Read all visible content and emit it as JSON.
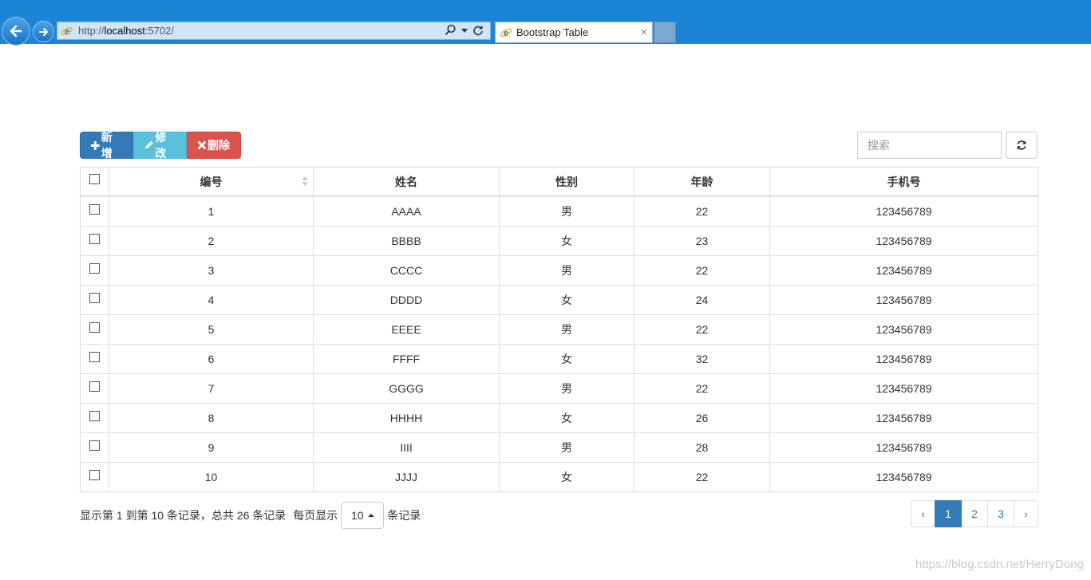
{
  "browser": {
    "url_prefix": "http://",
    "url_host": "localhost",
    "url_suffix": ":5702/",
    "tab_title": "Bootstrap Table",
    "tab_close": "×"
  },
  "toolbar": {
    "add_label": "新增",
    "edit_label": "修改",
    "delete_label": "删除"
  },
  "search": {
    "placeholder": "搜索"
  },
  "table": {
    "headers": [
      "编号",
      "姓名",
      "性别",
      "年龄",
      "手机号"
    ],
    "rows": [
      [
        "1",
        "AAAA",
        "男",
        "22",
        "123456789"
      ],
      [
        "2",
        "BBBB",
        "女",
        "23",
        "123456789"
      ],
      [
        "3",
        "CCCC",
        "男",
        "22",
        "123456789"
      ],
      [
        "4",
        "DDDD",
        "女",
        "24",
        "123456789"
      ],
      [
        "5",
        "EEEE",
        "男",
        "22",
        "123456789"
      ],
      [
        "6",
        "FFFF",
        "女",
        "32",
        "123456789"
      ],
      [
        "7",
        "GGGG",
        "男",
        "22",
        "123456789"
      ],
      [
        "8",
        "HHHH",
        "女",
        "26",
        "123456789"
      ],
      [
        "9",
        "IIII",
        "男",
        "28",
        "123456789"
      ],
      [
        "10",
        "JJJJ",
        "女",
        "22",
        "123456789"
      ]
    ]
  },
  "footer": {
    "summary": "显示第 1 到第 10 条记录，总共 26 条记录",
    "per_page_prefix": "每页显示",
    "page_size": "10",
    "per_page_suffix": "条记录"
  },
  "pagination": {
    "prev": "‹",
    "pages": [
      "1",
      "2",
      "3"
    ],
    "active_page": "1",
    "next": "›"
  },
  "watermark": "https://blog.csdn.net/HerryDong",
  "colors": {
    "chrome": "#1b84d4",
    "primary": "#337ab7",
    "info": "#5bc0de",
    "danger": "#d9534f"
  }
}
